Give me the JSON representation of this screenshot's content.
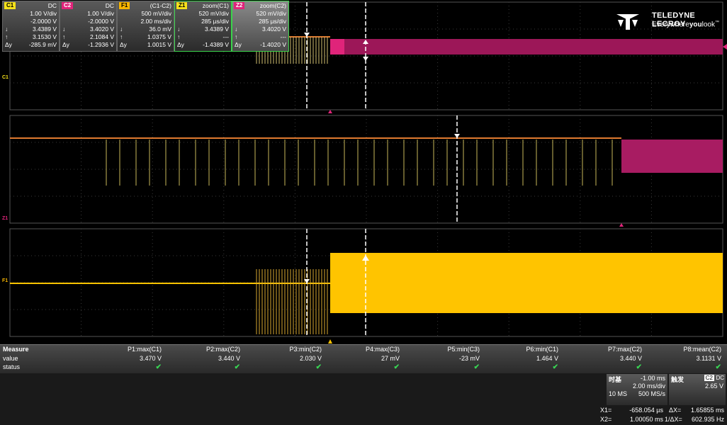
{
  "brand": {
    "name": "TELEDYNE LECROY",
    "tagline_prefix": "Everywhere",
    "tagline_bold": "you",
    "tagline_suffix": "look",
    "tm": "™"
  },
  "channel_labels": {
    "c1": "C1",
    "z1": "Z1",
    "f1": "F1"
  },
  "measure": {
    "title": "Measure",
    "row_value": "value",
    "row_status": "status",
    "params": [
      {
        "name": "P1:max(C1)",
        "value": "3.470 V"
      },
      {
        "name": "P2:max(C2)",
        "value": "3.440 V"
      },
      {
        "name": "P3:min(C2)",
        "value": "2.030 V"
      },
      {
        "name": "P4:max(C3)",
        "value": "27 mV"
      },
      {
        "name": "P5:min(C3)",
        "value": "-23 mV"
      },
      {
        "name": "P6:min(C1)",
        "value": "1.464 V"
      },
      {
        "name": "P7:max(C2)",
        "value": "3.440 V"
      },
      {
        "name": "P8:mean(C2)",
        "value": "3.1131 V"
      }
    ],
    "check_glyph": "✔"
  },
  "channels": [
    {
      "tag": "C1",
      "tag_color": "#f5e11a",
      "header": "DC",
      "scale": "1.00 V/div",
      "offset": "-2.0000 V",
      "down_sym": "↓",
      "down": "3.4389 V",
      "up_sym": "↑",
      "up": "3.1530 V",
      "delta_sym": "Δy",
      "delta": "-285.9 mV"
    },
    {
      "tag": "C2",
      "tag_color": "#e0247a",
      "header": "DC",
      "scale": "1.00 V/div",
      "offset": "-2.0000 V",
      "down_sym": "↓",
      "down": "3.4020 V",
      "up_sym": "↑",
      "up": "2.1084 V",
      "delta_sym": "Δy",
      "delta": "-1.2936 V"
    },
    {
      "tag": "F1",
      "tag_color": "#f7b500",
      "header": "(C1-C2)",
      "scale": "500 mV/div",
      "offset": "2.00 ms/div",
      "down_sym": "↓",
      "down": "36.0 mV",
      "up_sym": "↑",
      "up": "1.0375 V",
      "delta_sym": "Δy",
      "delta": "1.0015 V"
    },
    {
      "tag": "Z1",
      "tag_color": "#f5e11a",
      "header": "zoom(C1)",
      "scale": "520 mV/div",
      "offset": "285 µs/div",
      "down_sym": "↓",
      "down": "3.4389 V",
      "up_sym": "↑",
      "up": "---",
      "delta_sym": "Δy",
      "delta": "-1.4389 V"
    },
    {
      "tag": "Z2",
      "tag_color": "#e0247a",
      "header": "zoom(C2)",
      "scale": "520 mV/div",
      "offset": "285 µs/div",
      "down_sym": "↓",
      "down": "3.4020 V",
      "up_sym": "↑",
      "up": "---",
      "delta_sym": "Δy",
      "delta": "-1.4020 V"
    }
  ],
  "timebase": {
    "label": "时基",
    "delay": "-1.00 ms",
    "hdiv": "2.00 ms/div",
    "samples": "10 MS",
    "rate": "500 MS/s"
  },
  "trigger": {
    "label": "触发",
    "source": "C2",
    "coupling": "DC",
    "level": "2.65 V"
  },
  "cursors": {
    "x1_label": "X1=",
    "x1": "-658.054 µs",
    "dx_label": "ΔX=",
    "dx": "1.65855 ms",
    "x2_label": "X2=",
    "x2": "1.00050 ms",
    "inv_label": "1/ΔX=",
    "inv": "602.935 Hz"
  },
  "colors": {
    "c1": "#f5e11a",
    "c2": "#c21a6c",
    "f1": "#ffc400",
    "grid": "#3a3a3a"
  }
}
